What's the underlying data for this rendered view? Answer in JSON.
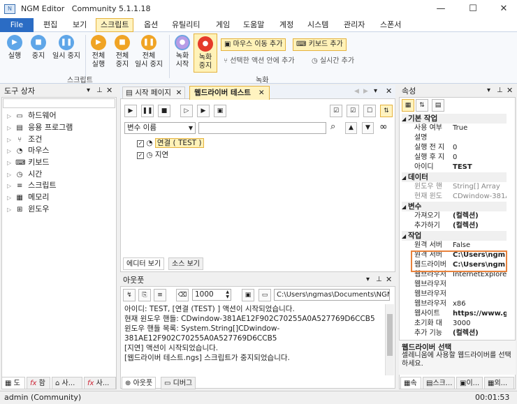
{
  "window": {
    "title_app": "NGM Editor",
    "title_edition": "Community 5.1.1.18",
    "minimize": "—",
    "maximize": "☐",
    "close": "✕",
    "icon_label": "N"
  },
  "menu": {
    "file": "File",
    "items": [
      "편집",
      "보기",
      "스크립트",
      "옵션",
      "유틸리티",
      "게임",
      "도움말",
      "계정",
      "시스템",
      "관리자",
      "스폰서"
    ]
  },
  "ribbon": {
    "script_buttons": [
      {
        "label1": "실행",
        "label2": "",
        "icon": "play-icon",
        "glyph": "▶"
      },
      {
        "label1": "중지",
        "label2": "",
        "icon": "stop-icon",
        "glyph": "■"
      },
      {
        "label1": "일시 중지",
        "label2": "",
        "icon": "pause-icon",
        "glyph": "❚❚"
      },
      {
        "label1": "전체",
        "label2": "실행",
        "icon": "play-all-icon",
        "glyph": "▶"
      },
      {
        "label1": "전체",
        "label2": "중지",
        "icon": "stop-all-icon",
        "glyph": "■"
      },
      {
        "label1": "전체",
        "label2": "일시 중지",
        "icon": "pause-all-icon",
        "glyph": "❚❚"
      }
    ],
    "script_group": "스크립트",
    "record_buttons": [
      {
        "label1": "녹화",
        "label2": "시작",
        "glyph": "●"
      },
      {
        "label1": "녹화",
        "label2": "중지",
        "glyph": "●"
      }
    ],
    "record_options": {
      "mouse": "마우스 이동 추가",
      "keyboard": "키보드 추가",
      "selected": "선택한 액션 안에 추가",
      "realtime": "실시간 추가"
    },
    "record_group": "녹화"
  },
  "toolbox": {
    "title": "도구 상자",
    "items": [
      {
        "label": "하드웨어",
        "glyph": "▭"
      },
      {
        "label": "응용 프로그램",
        "glyph": "▤"
      },
      {
        "label": "조건",
        "glyph": "⑂"
      },
      {
        "label": "마우스",
        "glyph": "◔"
      },
      {
        "label": "키보드",
        "glyph": "⌨"
      },
      {
        "label": "시간",
        "glyph": "◷"
      },
      {
        "label": "스크립트",
        "glyph": "≡"
      },
      {
        "label": "메모리",
        "glyph": "▦"
      },
      {
        "label": "윈도우",
        "glyph": "⊞"
      }
    ],
    "bottom_tabs": [
      "도",
      "함",
      "사...",
      "사..."
    ]
  },
  "editor": {
    "tabs": [
      "시작 페이지",
      "웹드라이버 테스트"
    ],
    "var_select": "변수 이름",
    "var_search": "",
    "tree": [
      {
        "label": "연결 ( TEST )",
        "checked": true,
        "selected": true
      },
      {
        "label": "지연",
        "checked": true,
        "selected": false
      }
    ],
    "view_tabs": [
      "에디터 보기",
      "소스 보기"
    ]
  },
  "output": {
    "title": "아웃풋",
    "limit": "1000",
    "path": "C:\\Users\\ngmas\\Documents\\NGM5\\",
    "lines": [
      "아이디: TEST, [연결 (TEST) ] 액션이 시작되었습니다.",
      "현재 윈도우 핸들: CDwindow-381AE12F902C70255A0A527769D6CCB5",
      "윈도우 핸들 목록: System.String[]CDwindow-",
      "381AE12F902C70255A0A527769D6CCB5",
      "[지연] 액션이 시작되었습니다.",
      "[웹드라이버 테스트.ngs] 스크립트가 중지되었습니다."
    ],
    "bottom_tabs": [
      "아웃풋",
      "디버그"
    ]
  },
  "properties": {
    "title": "속성",
    "categories": [
      {
        "name": "기본 작업",
        "rows": [
          [
            "사용 여부",
            "True",
            false
          ],
          [
            "설명",
            "",
            false
          ],
          [
            "실행 전 지",
            "0",
            false
          ],
          [
            "실행 후 지",
            "0",
            false
          ],
          [
            "아이디",
            "TEST",
            true
          ]
        ]
      },
      {
        "name": "데이터",
        "rows": [
          [
            "윈도우 핸",
            "String[] Array",
            false,
            true
          ],
          [
            "현재 윈도",
            "CDwindow-381AE",
            false,
            true
          ]
        ]
      },
      {
        "name": "변수",
        "rows": [
          [
            "가져오기",
            "(컬렉션)",
            true
          ],
          [
            "추가하기",
            "(컬렉션)",
            true
          ]
        ]
      },
      {
        "name": "작업",
        "rows": [
          [
            "원격 서버",
            "False",
            false
          ],
          [
            "원격 서버",
            "C:\\Users\\ngm",
            true
          ],
          [
            "웹드라이버",
            "C:\\Users\\ngm",
            true
          ],
          [
            "웹브라우저",
            "InternetExplorer",
            false
          ],
          [
            "웹브라우저",
            "",
            false
          ],
          [
            "웹브라우저",
            "",
            false
          ],
          [
            "웹브라우저",
            "x86",
            false
          ],
          [
            "웹사이트",
            "https://www.g",
            true
          ],
          [
            "초기화 대",
            "3000",
            false
          ],
          [
            "추가 기능",
            "(컬렉션)",
            true
          ]
        ]
      }
    ],
    "desc_title": "웹드라이버 선택",
    "desc_text": "셀레니움에 사용할 웹드라이버를 선택하세요.",
    "bottom_tabs": [
      "속",
      "스크...",
      "이...",
      "외..."
    ]
  },
  "status": {
    "user": "admin (Community)",
    "time": "00:01:53"
  }
}
